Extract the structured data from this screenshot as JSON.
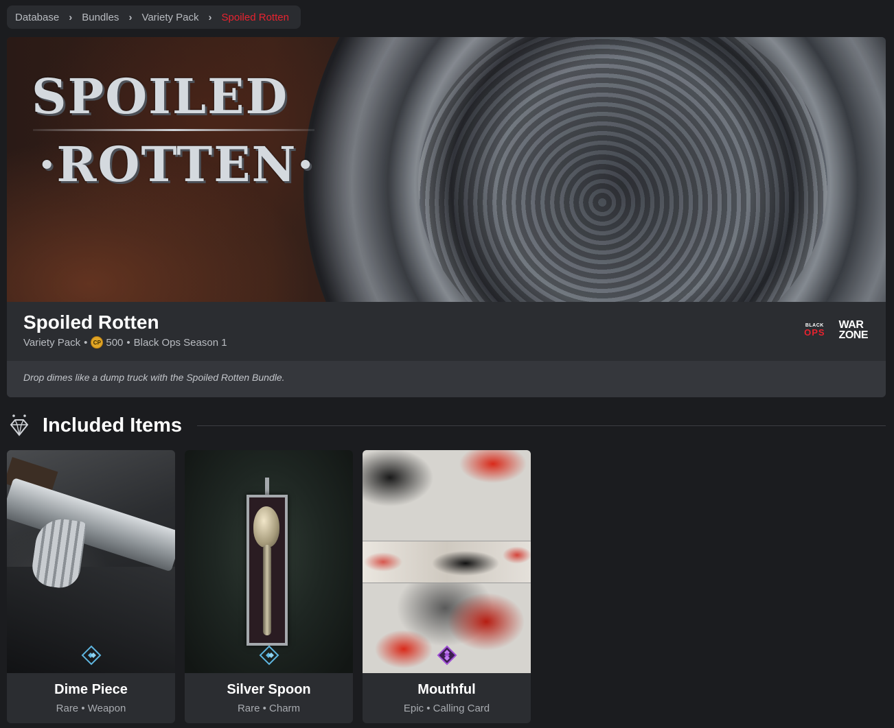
{
  "breadcrumb": {
    "items": [
      "Database",
      "Bundles",
      "Variety Pack",
      "Spoiled Rotten"
    ],
    "separator": "›"
  },
  "banner": {
    "title_line1": "SPOILED",
    "title_line2": "·ROTTEN·"
  },
  "bundle": {
    "name": "Spoiled Rotten",
    "type": "Variety Pack",
    "currency_icon": "CP",
    "price": "500",
    "season": "Black Ops Season 1",
    "description": "Drop dimes like a dump truck with the Spoiled Rotten Bundle.",
    "games": {
      "black_ops_top": "BLACK",
      "black_ops_bottom": "OPS",
      "warzone_top": "WAR",
      "warzone_bottom": "ZONE"
    }
  },
  "section": {
    "title": "Included Items",
    "icon": "diamond-icon"
  },
  "items": [
    {
      "name": "Dime Piece",
      "rarity": "Rare",
      "category": "Weapon",
      "rarity_color": "#5fb6e0",
      "meta": "Rare • Weapon"
    },
    {
      "name": "Silver Spoon",
      "rarity": "Rare",
      "category": "Charm",
      "rarity_color": "#5fb6e0",
      "meta": "Rare • Charm"
    },
    {
      "name": "Mouthful",
      "rarity": "Epic",
      "category": "Calling Card",
      "rarity_color": "#a04fd6",
      "meta": "Epic • Calling Card"
    }
  ],
  "colors": {
    "accent": "#e8232f",
    "background": "#1b1c1f",
    "card": "#2b2d31"
  }
}
